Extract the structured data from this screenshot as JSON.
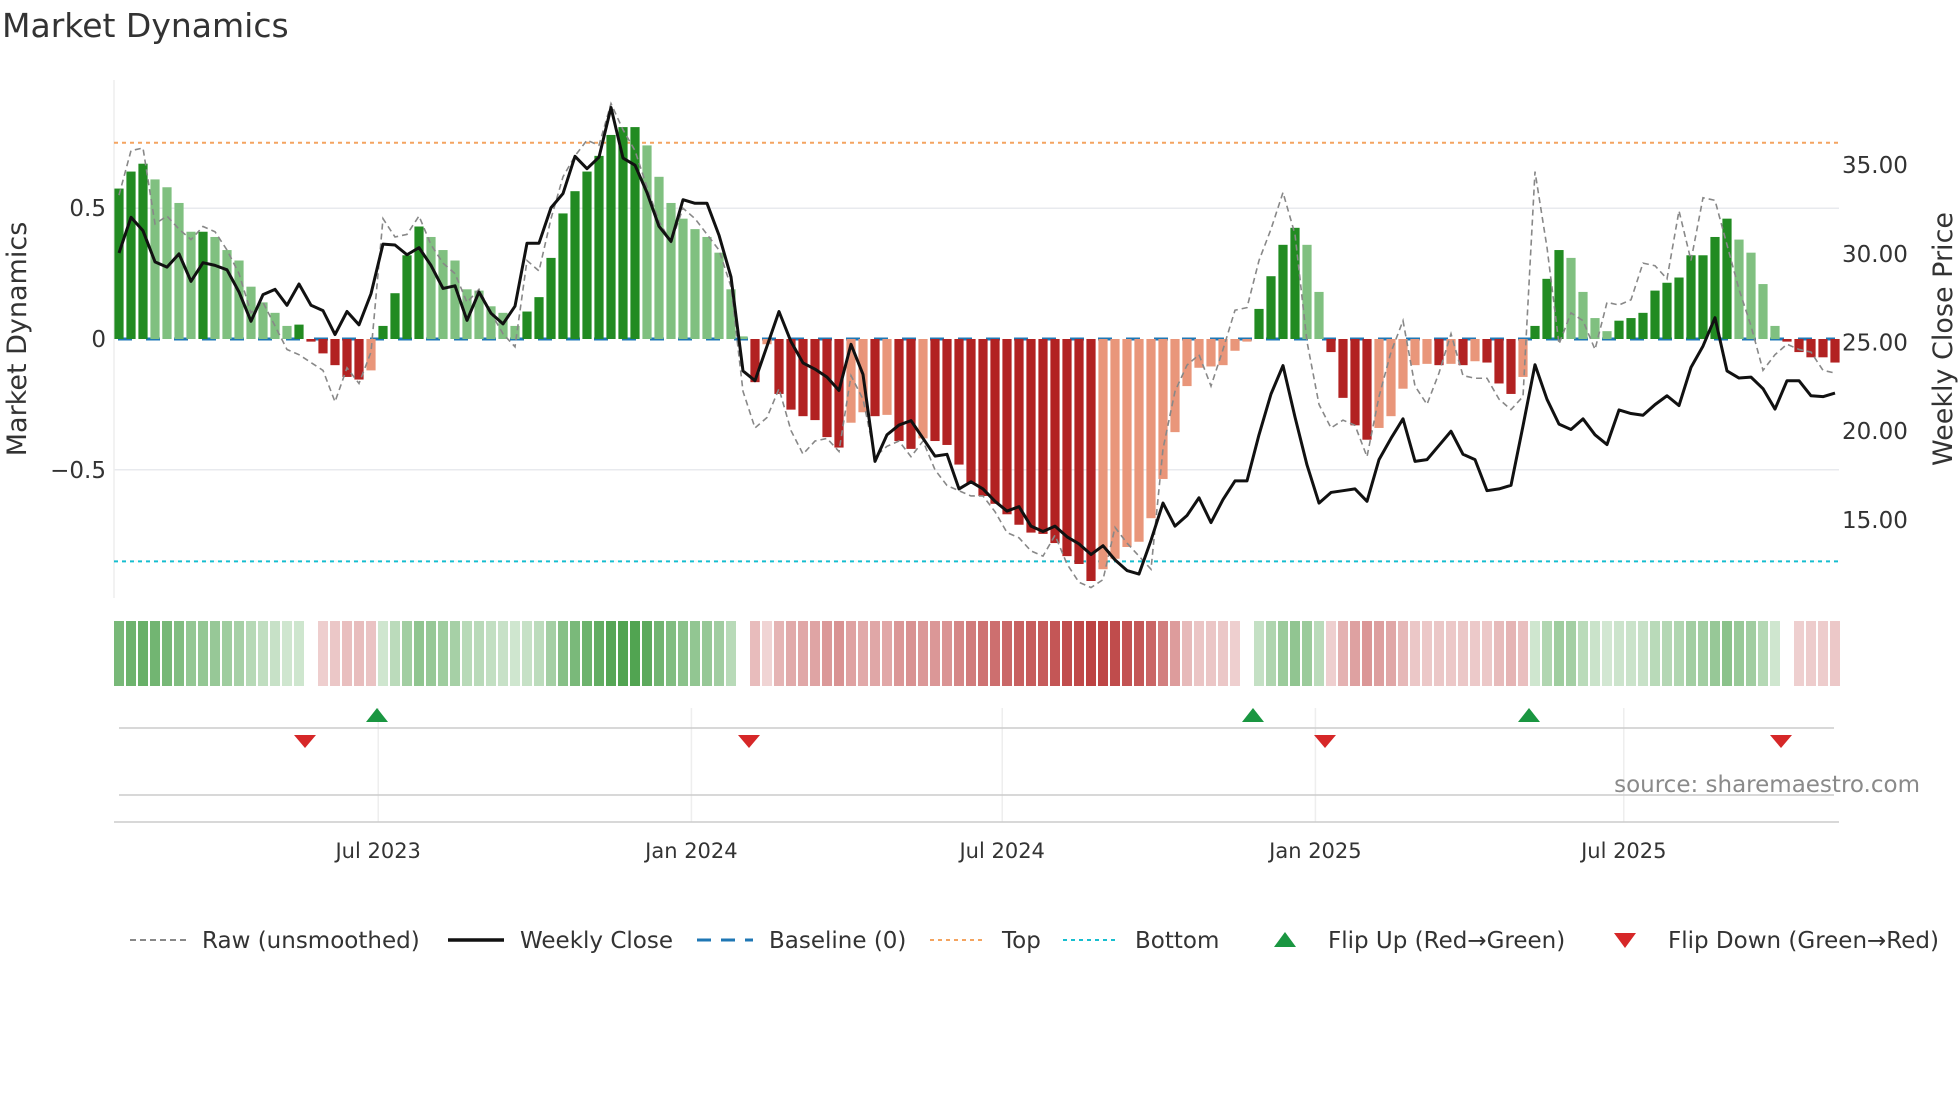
{
  "title": "Market Dynamics",
  "source": "source: sharemaestro.com",
  "colors": {
    "green_dark": "#228b22",
    "green_light": "#80c080",
    "red_dark": "#b22222",
    "red_light": "#e9967a",
    "raw": "#888888",
    "close": "#111111",
    "baseline": "#1f77b4",
    "top": "#f4a460",
    "bottom": "#17becf",
    "flip_up": "#1a9641",
    "flip_down": "#d62728"
  },
  "chart_data": {
    "type": "bar",
    "title": "Market Dynamics",
    "ylabel": "Market Dynamics",
    "ylabel_right": "Weekly Close Price",
    "ylim": [
      -0.99,
      0.99
    ],
    "ylim_right": [
      10.6,
      39.8
    ],
    "yticks": [
      {
        "value": 0.5,
        "label": "0.5"
      },
      {
        "value": 0,
        "label": "0"
      },
      {
        "value": -0.5,
        "label": "−0.5"
      }
    ],
    "yticks_right": [
      {
        "value": 35,
        "label": "35.00"
      },
      {
        "value": 30,
        "label": "30.00"
      },
      {
        "value": 25,
        "label": "25.00"
      },
      {
        "value": 20,
        "label": "20.00"
      },
      {
        "value": 15,
        "label": "15.00"
      }
    ],
    "xticks": [
      {
        "week": 21.6,
        "label": "Jul 2023"
      },
      {
        "week": 47.7,
        "label": "Jan 2024"
      },
      {
        "week": 73.6,
        "label": "Jul 2024"
      },
      {
        "week": 99.7,
        "label": "Jan 2025"
      },
      {
        "week": 125.4,
        "label": "Jul 2025"
      }
    ],
    "top_level": 0.75,
    "bottom_level": -0.85,
    "baseline": 0,
    "grid": true,
    "legend_position": "bottom",
    "momentum": [
      0.575,
      0.64,
      0.67,
      0.61,
      0.58,
      0.52,
      0.41,
      0.41,
      0.39,
      0.34,
      0.3,
      0.2,
      0.14,
      0.1,
      0.05,
      0.055,
      -0.01,
      -0.055,
      -0.1,
      -0.145,
      -0.155,
      -0.12,
      0.05,
      0.175,
      0.32,
      0.43,
      0.39,
      0.34,
      0.3,
      0.19,
      0.185,
      0.125,
      0.1,
      0.05,
      0.105,
      0.16,
      0.31,
      0.48,
      0.565,
      0.64,
      0.7,
      0.78,
      0.81,
      0.81,
      0.74,
      0.62,
      0.52,
      0.46,
      0.42,
      0.39,
      0.33,
      0.19,
      0.01,
      -0.165,
      -0.02,
      -0.21,
      -0.27,
      -0.295,
      -0.31,
      -0.375,
      -0.415,
      -0.32,
      -0.28,
      -0.295,
      -0.29,
      -0.39,
      -0.42,
      -0.38,
      -0.39,
      -0.405,
      -0.48,
      -0.55,
      -0.6,
      -0.63,
      -0.67,
      -0.71,
      -0.74,
      -0.745,
      -0.78,
      -0.83,
      -0.86,
      -0.925,
      -0.88,
      -0.84,
      -0.795,
      -0.775,
      -0.685,
      -0.535,
      -0.356,
      -0.18,
      -0.11,
      -0.105,
      -0.1,
      -0.045,
      -0.01,
      0.115,
      0.24,
      0.36,
      0.425,
      0.36,
      0.18,
      -0.05,
      -0.225,
      -0.33,
      -0.385,
      -0.34,
      -0.295,
      -0.19,
      -0.1,
      -0.095,
      -0.1,
      -0.095,
      -0.1,
      -0.085,
      -0.09,
      -0.17,
      -0.21,
      -0.145,
      0.05,
      0.23,
      0.34,
      0.31,
      0.18,
      0.08,
      0.03,
      0.07,
      0.08,
      0.1,
      0.185,
      0.215,
      0.235,
      0.32,
      0.32,
      0.39,
      0.46,
      0.38,
      0.33,
      0.21,
      0.05,
      -0.01,
      -0.05,
      -0.07,
      -0.07,
      -0.09
    ],
    "raw": [
      0.55,
      0.72,
      0.73,
      0.44,
      0.47,
      0.42,
      0.38,
      0.43,
      0.41,
      0.34,
      0.25,
      0.1,
      0.14,
      0.05,
      -0.04,
      -0.06,
      -0.09,
      -0.12,
      -0.24,
      -0.11,
      -0.17,
      -0.05,
      0.46,
      0.39,
      0.4,
      0.47,
      0.36,
      0.29,
      0.25,
      0.14,
      0.19,
      0.1,
      0.02,
      -0.03,
      0.3,
      0.26,
      0.46,
      0.62,
      0.7,
      0.76,
      0.74,
      0.9,
      0.8,
      0.72,
      0.58,
      0.45,
      0.37,
      0.5,
      0.46,
      0.4,
      0.34,
      0.2,
      -0.2,
      -0.34,
      -0.3,
      -0.19,
      -0.35,
      -0.44,
      -0.39,
      -0.38,
      -0.43,
      -0.14,
      -0.23,
      -0.45,
      -0.41,
      -0.39,
      -0.45,
      -0.39,
      -0.5,
      -0.56,
      -0.58,
      -0.6,
      -0.6,
      -0.66,
      -0.74,
      -0.76,
      -0.81,
      -0.83,
      -0.75,
      -0.86,
      -0.93,
      -0.95,
      -0.92,
      -0.72,
      -0.78,
      -0.83,
      -0.88,
      -0.42,
      -0.2,
      -0.1,
      -0.06,
      -0.18,
      -0.04,
      0.11,
      0.12,
      0.3,
      0.42,
      0.56,
      0.4,
      -0.01,
      -0.25,
      -0.34,
      -0.31,
      -0.33,
      -0.45,
      -0.22,
      -0.05,
      0.07,
      -0.18,
      -0.25,
      -0.13,
      0.02,
      -0.14,
      -0.15,
      -0.15,
      -0.23,
      -0.27,
      -0.22,
      0.64,
      0.35,
      -0.02,
      0.1,
      0.07,
      -0.04,
      0.14,
      0.13,
      0.15,
      0.29,
      0.28,
      0.23,
      0.49,
      0.3,
      0.54,
      0.53,
      0.36,
      0.19,
      0.05,
      -0.12,
      -0.06,
      -0.02,
      -0.04,
      -0.05,
      -0.12,
      -0.13
    ],
    "close": [
      30.05,
      32.06,
      31.3,
      29.55,
      29.25,
      30.0,
      28.45,
      29.5,
      29.35,
      29.1,
      27.85,
      26.2,
      27.7,
      28.0,
      27.1,
      28.3,
      27.1,
      26.8,
      25.45,
      26.75,
      26.0,
      27.75,
      30.55,
      30.5,
      29.95,
      30.35,
      29.35,
      28.05,
      28.2,
      26.25,
      27.85,
      26.65,
      26.05,
      27.05,
      30.6,
      30.6,
      32.6,
      33.4,
      35.5,
      34.8,
      35.45,
      38.25,
      35.4,
      35.0,
      33.45,
      31.55,
      30.7,
      33.05,
      32.85,
      32.85,
      31.05,
      28.7,
      23.4,
      22.85,
      24.8,
      26.75,
      25.05,
      23.85,
      23.5,
      23.05,
      22.3,
      24.9,
      23.2,
      18.3,
      19.8,
      20.35,
      20.6,
      19.6,
      18.6,
      18.7,
      16.75,
      17.15,
      16.75,
      16.05,
      15.5,
      15.75,
      14.65,
      14.35,
      14.65,
      14.05,
      13.65,
      13.05,
      13.55,
      12.75,
      12.15,
      11.95,
      13.85,
      15.95,
      14.65,
      15.25,
      16.25,
      14.85,
      16.15,
      17.2,
      17.2,
      19.8,
      22.1,
      23.7,
      20.8,
      18.1,
      15.95,
      16.55,
      16.65,
      16.75,
      16.05,
      18.4,
      19.6,
      20.7,
      18.3,
      18.4,
      19.2,
      20.0,
      18.7,
      18.4,
      16.65,
      16.75,
      16.95,
      20.3,
      23.75,
      21.8,
      20.4,
      20.1,
      20.7,
      19.8,
      19.25,
      21.2,
      21.0,
      20.9,
      21.5,
      22.0,
      21.45,
      23.6,
      24.8,
      26.4,
      23.4,
      23.0,
      23.05,
      22.4,
      21.25,
      22.85,
      22.85,
      22.0,
      21.95,
      22.15
    ],
    "flip_up_weeks": [
      22,
      95,
      118
    ],
    "flip_down_weeks": [
      16,
      53,
      101,
      139
    ]
  },
  "legend": [
    {
      "key": "raw",
      "label": "Raw (unsmoothed)"
    },
    {
      "key": "close",
      "label": "Weekly Close"
    },
    {
      "key": "baseline",
      "label": "Baseline (0)"
    },
    {
      "key": "top",
      "label": "Top"
    },
    {
      "key": "bottom",
      "label": "Bottom"
    },
    {
      "key": "flip_up",
      "label": "Flip Up (Red→Green)"
    },
    {
      "key": "flip_down",
      "label": "Flip Down (Green→Red)"
    }
  ]
}
